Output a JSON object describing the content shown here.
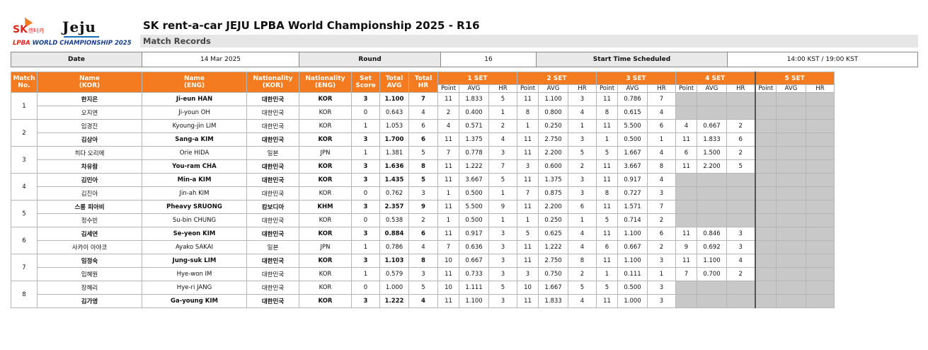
{
  "header": {
    "logo": {
      "sk": "SK",
      "rent": "렌터카",
      "jeju": "Jeju",
      "lpba": "LPBA",
      "wc": "WORLD CHAMPIONSHIP 2025"
    },
    "title": "SK rent-a-car JEJU LPBA World Championship 2025 - R16",
    "subtitle": "Match Records"
  },
  "info": {
    "date_label": "Date",
    "date_value": "14 Mar 2025",
    "round_label": "Round",
    "round_value": "16",
    "start_label": "Start Time Scheduled",
    "start_value": "14:00 KST / 19:00 KST"
  },
  "columns": {
    "match_no": [
      "Match",
      "No."
    ],
    "name_kor": [
      "Name",
      "(KOR)"
    ],
    "name_eng": [
      "Name",
      "(ENG)"
    ],
    "nat_kor": [
      "Nationality",
      "(KOR)"
    ],
    "nat_eng": [
      "Nationality",
      "(ENG)"
    ],
    "set_score": [
      "Set",
      "Score"
    ],
    "total_avg": [
      "Total",
      "AVG"
    ],
    "total_hr": [
      "Total",
      "HR"
    ],
    "sets": [
      "1 SET",
      "2 SET",
      "3 SET",
      "4 SET",
      "5 SET"
    ],
    "set_sub": [
      "Point",
      "AVG",
      "HR"
    ]
  },
  "rows": [
    {
      "match": "1",
      "kor": "한지은",
      "eng": "Ji-eun HAN",
      "natk": "대한민국",
      "nate": "KOR",
      "score": "3",
      "avg": "1.100",
      "hr": "7",
      "win": true,
      "sets": [
        [
          "11",
          "1.833",
          "5"
        ],
        [
          "11",
          "1.100",
          "3"
        ],
        [
          "11",
          "0.786",
          "7"
        ]
      ]
    },
    {
      "match": "1",
      "kor": "오지연",
      "eng": "Ji-youn OH",
      "natk": "대한민국",
      "nate": "KOR",
      "score": "0",
      "avg": "0.643",
      "hr": "4",
      "win": false,
      "sets": [
        [
          "2",
          "0.400",
          "1"
        ],
        [
          "8",
          "0.800",
          "4"
        ],
        [
          "8",
          "0.615",
          "4"
        ]
      ]
    },
    {
      "match": "2",
      "kor": "임경진",
      "eng": "Kyoung-jin LIM",
      "natk": "대한민국",
      "nate": "KOR",
      "score": "1",
      "avg": "1.053",
      "hr": "6",
      "win": false,
      "sets": [
        [
          "4",
          "0.571",
          "2"
        ],
        [
          "1",
          "0.250",
          "1"
        ],
        [
          "11",
          "5.500",
          "6"
        ],
        [
          "4",
          "0.667",
          "2"
        ]
      ]
    },
    {
      "match": "2",
      "kor": "김상아",
      "eng": "Sang-a KIM",
      "natk": "대한민국",
      "nate": "KOR",
      "score": "3",
      "avg": "1.700",
      "hr": "6",
      "win": true,
      "sets": [
        [
          "11",
          "1.375",
          "4"
        ],
        [
          "11",
          "2.750",
          "3"
        ],
        [
          "1",
          "0.500",
          "1"
        ],
        [
          "11",
          "1.833",
          "6"
        ]
      ]
    },
    {
      "match": "3",
      "kor": "히다 오리에",
      "eng": "Orie HIDA",
      "natk": "일본",
      "nate": "JPN",
      "score": "1",
      "avg": "1.381",
      "hr": "5",
      "win": false,
      "sets": [
        [
          "7",
          "0.778",
          "3"
        ],
        [
          "11",
          "2.200",
          "5"
        ],
        [
          "5",
          "1.667",
          "4"
        ],
        [
          "6",
          "1.500",
          "2"
        ]
      ]
    },
    {
      "match": "3",
      "kor": "차유람",
      "eng": "You-ram CHA",
      "natk": "대한민국",
      "nate": "KOR",
      "score": "3",
      "avg": "1.636",
      "hr": "8",
      "win": true,
      "sets": [
        [
          "11",
          "1.222",
          "7"
        ],
        [
          "3",
          "0.600",
          "2"
        ],
        [
          "11",
          "3.667",
          "8"
        ],
        [
          "11",
          "2.200",
          "5"
        ]
      ]
    },
    {
      "match": "4",
      "kor": "김민아",
      "eng": "Min-a KIM",
      "natk": "대한민국",
      "nate": "KOR",
      "score": "3",
      "avg": "1.435",
      "hr": "5",
      "win": true,
      "sets": [
        [
          "11",
          "3.667",
          "5"
        ],
        [
          "11",
          "1.375",
          "3"
        ],
        [
          "11",
          "0.917",
          "4"
        ]
      ]
    },
    {
      "match": "4",
      "kor": "김진아",
      "eng": "Jin-ah KIM",
      "natk": "대한민국",
      "nate": "KOR",
      "score": "0",
      "avg": "0.762",
      "hr": "3",
      "win": false,
      "sets": [
        [
          "1",
          "0.500",
          "1"
        ],
        [
          "7",
          "0.875",
          "3"
        ],
        [
          "8",
          "0.727",
          "3"
        ]
      ]
    },
    {
      "match": "5",
      "kor": "스롱 피아비",
      "eng": "Pheavy SRUONG",
      "natk": "캄보디아",
      "nate": "KHM",
      "score": "3",
      "avg": "2.357",
      "hr": "9",
      "win": true,
      "sets": [
        [
          "11",
          "5.500",
          "9"
        ],
        [
          "11",
          "2.200",
          "6"
        ],
        [
          "11",
          "1.571",
          "7"
        ]
      ]
    },
    {
      "match": "5",
      "kor": "정수빈",
      "eng": "Su-bin CHUNG",
      "natk": "대한민국",
      "nate": "KOR",
      "score": "0",
      "avg": "0.538",
      "hr": "2",
      "win": false,
      "sets": [
        [
          "1",
          "0.500",
          "1"
        ],
        [
          "1",
          "0.250",
          "1"
        ],
        [
          "5",
          "0.714",
          "2"
        ]
      ]
    },
    {
      "match": "6",
      "kor": "김세연",
      "eng": "Se-yeon KIM",
      "natk": "대한민국",
      "nate": "KOR",
      "score": "3",
      "avg": "0.884",
      "hr": "6",
      "win": true,
      "sets": [
        [
          "11",
          "0.917",
          "3"
        ],
        [
          "5",
          "0.625",
          "4"
        ],
        [
          "11",
          "1.100",
          "6"
        ],
        [
          "11",
          "0.846",
          "3"
        ]
      ]
    },
    {
      "match": "6",
      "kor": "사카이 아야코",
      "eng": "Ayako SAKAI",
      "natk": "일본",
      "nate": "JPN",
      "score": "1",
      "avg": "0.786",
      "hr": "4",
      "win": false,
      "sets": [
        [
          "7",
          "0.636",
          "3"
        ],
        [
          "11",
          "1.222",
          "4"
        ],
        [
          "6",
          "0.667",
          "2"
        ],
        [
          "9",
          "0.692",
          "3"
        ]
      ]
    },
    {
      "match": "7",
      "kor": "임정숙",
      "eng": "Jung-suk LIM",
      "natk": "대한민국",
      "nate": "KOR",
      "score": "3",
      "avg": "1.103",
      "hr": "8",
      "win": true,
      "sets": [
        [
          "10",
          "0.667",
          "3"
        ],
        [
          "11",
          "2.750",
          "8"
        ],
        [
          "11",
          "1.100",
          "3"
        ],
        [
          "11",
          "1.100",
          "4"
        ]
      ]
    },
    {
      "match": "7",
      "kor": "임혜원",
      "eng": "Hye-won IM",
      "natk": "대한민국",
      "nate": "KOR",
      "score": "1",
      "avg": "0.579",
      "hr": "3",
      "win": false,
      "sets": [
        [
          "11",
          "0.733",
          "3"
        ],
        [
          "3",
          "0.750",
          "2"
        ],
        [
          "1",
          "0.111",
          "1"
        ],
        [
          "7",
          "0.700",
          "2"
        ]
      ]
    },
    {
      "match": "8",
      "kor": "장혜리",
      "eng": "Hye-ri JANG",
      "natk": "대한민국",
      "nate": "KOR",
      "score": "0",
      "avg": "1.000",
      "hr": "5",
      "win": false,
      "sets": [
        [
          "10",
          "1.111",
          "5"
        ],
        [
          "10",
          "1.667",
          "5"
        ],
        [
          "5",
          "0.500",
          "3"
        ]
      ]
    },
    {
      "match": "8",
      "kor": "김가영",
      "eng": "Ga-young KIM",
      "natk": "대한민국",
      "nate": "KOR",
      "score": "3",
      "avg": "1.222",
      "hr": "4",
      "win": true,
      "sets": [
        [
          "11",
          "1.100",
          "3"
        ],
        [
          "11",
          "1.833",
          "4"
        ],
        [
          "11",
          "1.000",
          "3"
        ]
      ]
    }
  ]
}
